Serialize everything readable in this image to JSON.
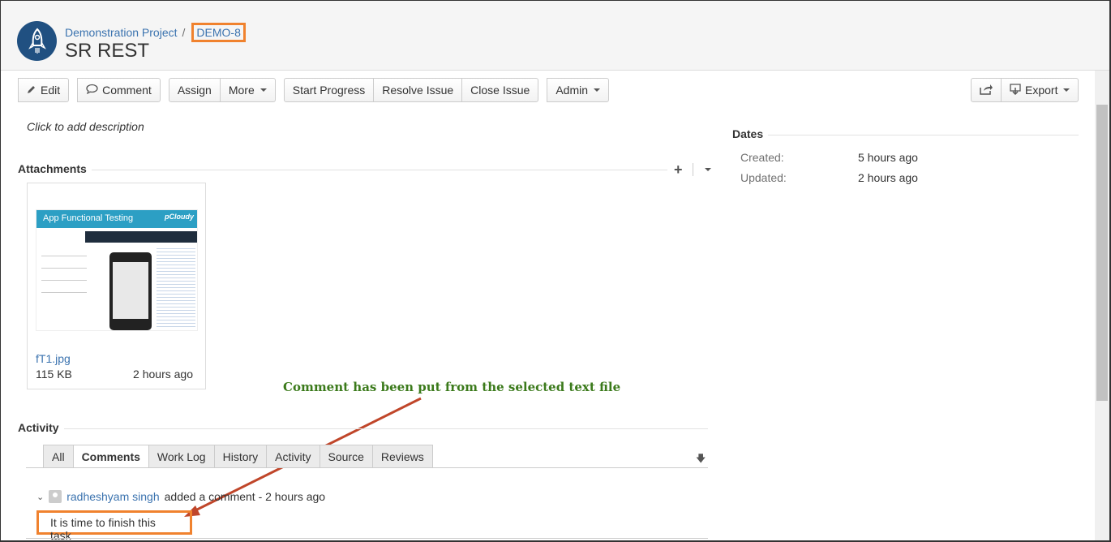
{
  "header": {
    "project": "Demonstration Project",
    "separator": "/",
    "issue_key": "DEMO-8",
    "title": "SR REST"
  },
  "toolbar": {
    "edit": "Edit",
    "comment": "Comment",
    "assign": "Assign",
    "more": "More",
    "start_progress": "Start Progress",
    "resolve_issue": "Resolve Issue",
    "close_issue": "Close Issue",
    "admin": "Admin",
    "export": "Export"
  },
  "description": {
    "placeholder": "Click to add description"
  },
  "attachments": {
    "title": "Attachments",
    "file": {
      "name": "fT1.jpg",
      "size": "115 KB",
      "time": "2 hours ago",
      "thumb_title": "App Functional Testing",
      "thumb_logo": "pCloudy"
    }
  },
  "annotation": "Comment has been put from the selected text file",
  "activity": {
    "title": "Activity",
    "tabs": [
      "All",
      "Comments",
      "Work Log",
      "History",
      "Activity",
      "Source",
      "Reviews"
    ],
    "active_tab": "Comments",
    "comment": {
      "user": "radheshyam singh",
      "action": "added a comment - 2 hours ago",
      "body": "It is time to finish this task"
    }
  },
  "dates": {
    "title": "Dates",
    "created_label": "Created:",
    "created_value": "5 hours ago",
    "updated_label": "Updated:",
    "updated_value": "2 hours ago"
  },
  "colors": {
    "link": "#3b73af",
    "highlight": "#f0822e",
    "annotation": "#3b7a1b",
    "arrow": "#c0462a"
  },
  "icons": {
    "avatar": "rocket-icon",
    "edit": "pencil-icon",
    "comment": "speech-bubble-icon",
    "share": "share-icon",
    "export": "export-icon"
  }
}
